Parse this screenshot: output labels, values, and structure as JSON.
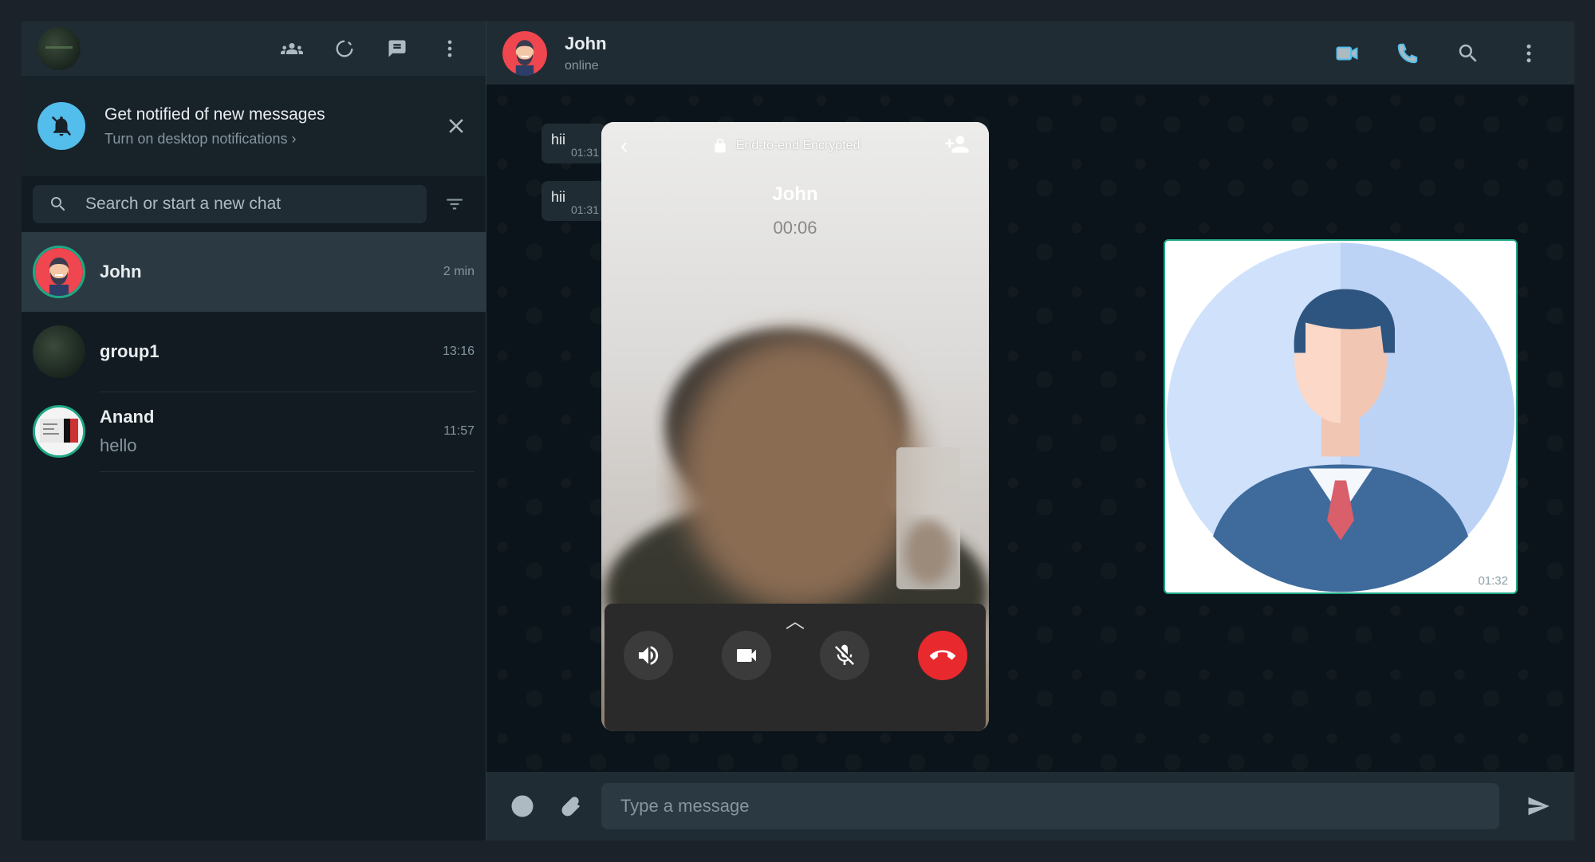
{
  "sidebar": {
    "notification": {
      "title": "Get notified of new messages",
      "subtitle": "Turn on desktop notifications ›"
    },
    "search": {
      "placeholder": "Search or start a new chat"
    },
    "chats": [
      {
        "name": "John",
        "last": "",
        "time": "2 min"
      },
      {
        "name": "group1",
        "last": "",
        "time": "13:16"
      },
      {
        "name": "Anand",
        "last": "hello",
        "time": "11:57"
      }
    ]
  },
  "main": {
    "contact": {
      "name": "John",
      "status": "online"
    },
    "messages": [
      {
        "text": "hii",
        "time": "01:31"
      },
      {
        "text": "hii",
        "time": "01:31"
      }
    ],
    "image_message_time": "01:32",
    "composer": {
      "placeholder": "Type a message"
    }
  },
  "call": {
    "encryption": "End-to-end Encrypted",
    "name": "John",
    "timer": "00:06"
  },
  "colors": {
    "accent": "#1fa885",
    "icon_blue": "#53bdeb",
    "end_call": "#e8292e"
  }
}
